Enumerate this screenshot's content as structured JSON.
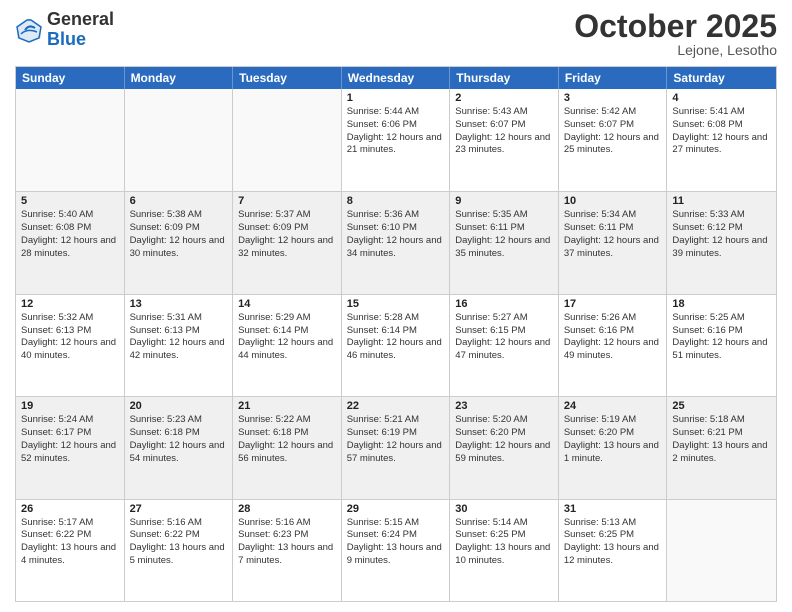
{
  "header": {
    "logo": {
      "general": "General",
      "blue": "Blue"
    },
    "month": "October 2025",
    "location": "Lejone, Lesotho"
  },
  "weekdays": [
    "Sunday",
    "Monday",
    "Tuesday",
    "Wednesday",
    "Thursday",
    "Friday",
    "Saturday"
  ],
  "weeks": [
    [
      {
        "day": "",
        "info": ""
      },
      {
        "day": "",
        "info": ""
      },
      {
        "day": "",
        "info": ""
      },
      {
        "day": "1",
        "info": "Sunrise: 5:44 AM\nSunset: 6:06 PM\nDaylight: 12 hours and 21 minutes."
      },
      {
        "day": "2",
        "info": "Sunrise: 5:43 AM\nSunset: 6:07 PM\nDaylight: 12 hours and 23 minutes."
      },
      {
        "day": "3",
        "info": "Sunrise: 5:42 AM\nSunset: 6:07 PM\nDaylight: 12 hours and 25 minutes."
      },
      {
        "day": "4",
        "info": "Sunrise: 5:41 AM\nSunset: 6:08 PM\nDaylight: 12 hours and 27 minutes."
      }
    ],
    [
      {
        "day": "5",
        "info": "Sunrise: 5:40 AM\nSunset: 6:08 PM\nDaylight: 12 hours and 28 minutes."
      },
      {
        "day": "6",
        "info": "Sunrise: 5:38 AM\nSunset: 6:09 PM\nDaylight: 12 hours and 30 minutes."
      },
      {
        "day": "7",
        "info": "Sunrise: 5:37 AM\nSunset: 6:09 PM\nDaylight: 12 hours and 32 minutes."
      },
      {
        "day": "8",
        "info": "Sunrise: 5:36 AM\nSunset: 6:10 PM\nDaylight: 12 hours and 34 minutes."
      },
      {
        "day": "9",
        "info": "Sunrise: 5:35 AM\nSunset: 6:11 PM\nDaylight: 12 hours and 35 minutes."
      },
      {
        "day": "10",
        "info": "Sunrise: 5:34 AM\nSunset: 6:11 PM\nDaylight: 12 hours and 37 minutes."
      },
      {
        "day": "11",
        "info": "Sunrise: 5:33 AM\nSunset: 6:12 PM\nDaylight: 12 hours and 39 minutes."
      }
    ],
    [
      {
        "day": "12",
        "info": "Sunrise: 5:32 AM\nSunset: 6:13 PM\nDaylight: 12 hours and 40 minutes."
      },
      {
        "day": "13",
        "info": "Sunrise: 5:31 AM\nSunset: 6:13 PM\nDaylight: 12 hours and 42 minutes."
      },
      {
        "day": "14",
        "info": "Sunrise: 5:29 AM\nSunset: 6:14 PM\nDaylight: 12 hours and 44 minutes."
      },
      {
        "day": "15",
        "info": "Sunrise: 5:28 AM\nSunset: 6:14 PM\nDaylight: 12 hours and 46 minutes."
      },
      {
        "day": "16",
        "info": "Sunrise: 5:27 AM\nSunset: 6:15 PM\nDaylight: 12 hours and 47 minutes."
      },
      {
        "day": "17",
        "info": "Sunrise: 5:26 AM\nSunset: 6:16 PM\nDaylight: 12 hours and 49 minutes."
      },
      {
        "day": "18",
        "info": "Sunrise: 5:25 AM\nSunset: 6:16 PM\nDaylight: 12 hours and 51 minutes."
      }
    ],
    [
      {
        "day": "19",
        "info": "Sunrise: 5:24 AM\nSunset: 6:17 PM\nDaylight: 12 hours and 52 minutes."
      },
      {
        "day": "20",
        "info": "Sunrise: 5:23 AM\nSunset: 6:18 PM\nDaylight: 12 hours and 54 minutes."
      },
      {
        "day": "21",
        "info": "Sunrise: 5:22 AM\nSunset: 6:18 PM\nDaylight: 12 hours and 56 minutes."
      },
      {
        "day": "22",
        "info": "Sunrise: 5:21 AM\nSunset: 6:19 PM\nDaylight: 12 hours and 57 minutes."
      },
      {
        "day": "23",
        "info": "Sunrise: 5:20 AM\nSunset: 6:20 PM\nDaylight: 12 hours and 59 minutes."
      },
      {
        "day": "24",
        "info": "Sunrise: 5:19 AM\nSunset: 6:20 PM\nDaylight: 13 hours and 1 minute."
      },
      {
        "day": "25",
        "info": "Sunrise: 5:18 AM\nSunset: 6:21 PM\nDaylight: 13 hours and 2 minutes."
      }
    ],
    [
      {
        "day": "26",
        "info": "Sunrise: 5:17 AM\nSunset: 6:22 PM\nDaylight: 13 hours and 4 minutes."
      },
      {
        "day": "27",
        "info": "Sunrise: 5:16 AM\nSunset: 6:22 PM\nDaylight: 13 hours and 5 minutes."
      },
      {
        "day": "28",
        "info": "Sunrise: 5:16 AM\nSunset: 6:23 PM\nDaylight: 13 hours and 7 minutes."
      },
      {
        "day": "29",
        "info": "Sunrise: 5:15 AM\nSunset: 6:24 PM\nDaylight: 13 hours and 9 minutes."
      },
      {
        "day": "30",
        "info": "Sunrise: 5:14 AM\nSunset: 6:25 PM\nDaylight: 13 hours and 10 minutes."
      },
      {
        "day": "31",
        "info": "Sunrise: 5:13 AM\nSunset: 6:25 PM\nDaylight: 13 hours and 12 minutes."
      },
      {
        "day": "",
        "info": ""
      }
    ]
  ]
}
